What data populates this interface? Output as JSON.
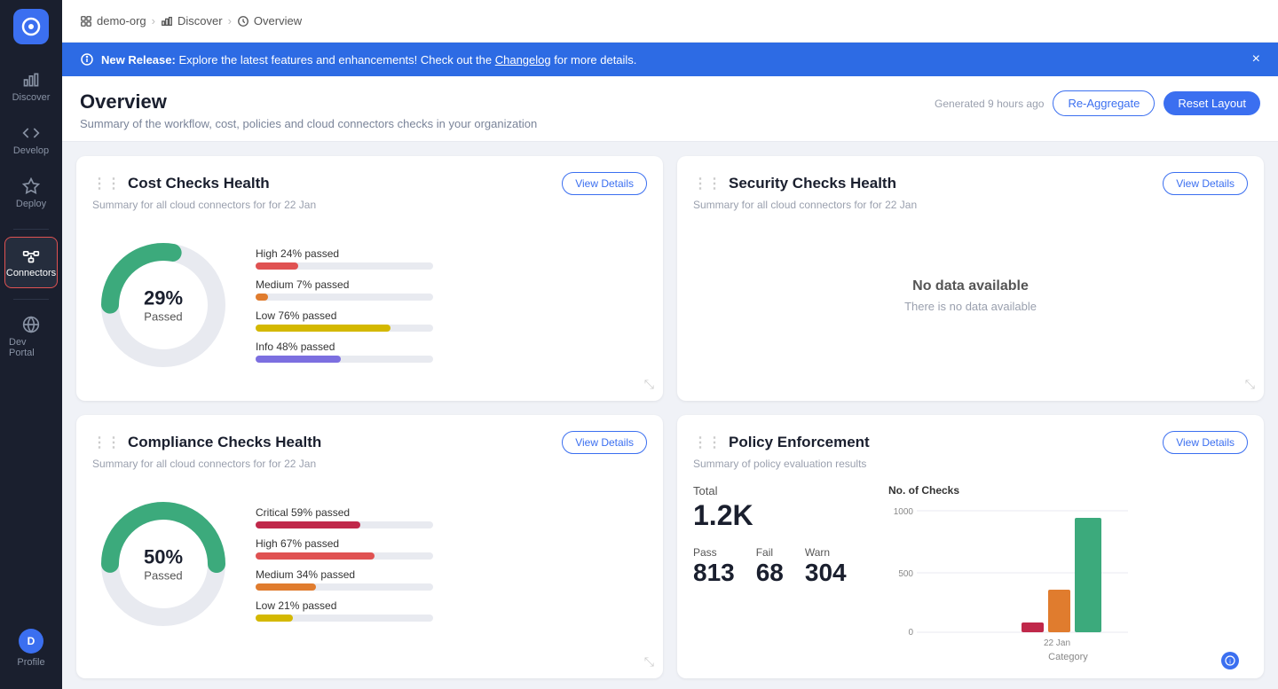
{
  "sidebar": {
    "logo": "app-logo",
    "items": [
      {
        "id": "discover",
        "label": "Discover",
        "icon": "bar-chart-icon",
        "active": false
      },
      {
        "id": "develop",
        "label": "Develop",
        "icon": "code-icon",
        "active": false
      },
      {
        "id": "deploy",
        "label": "Deploy",
        "icon": "deploy-icon",
        "active": false
      },
      {
        "id": "connectors",
        "label": "Connectors",
        "icon": "connectors-icon",
        "active": true
      },
      {
        "id": "dev-portal",
        "label": "Dev Portal",
        "icon": "portal-icon",
        "active": false
      }
    ],
    "bottom_items": [
      {
        "id": "profile",
        "label": "Profile",
        "icon": "profile-icon",
        "active": false
      }
    ]
  },
  "breadcrumb": {
    "items": [
      {
        "icon": "org-icon",
        "label": "demo-org"
      },
      {
        "icon": "discover-icon",
        "label": "Discover"
      },
      {
        "icon": "clock-icon",
        "label": "Overview"
      }
    ]
  },
  "banner": {
    "text_prefix": "New Release:",
    "text_body": " Explore the latest features and enhancements! Check out the ",
    "link_text": "Changelog",
    "text_suffix": " for more details.",
    "close_label": "×"
  },
  "page_header": {
    "title": "Overview",
    "subtitle": "Summary of the workflow, cost, policies and cloud connectors checks in your organization",
    "generated_text": "Generated 9 hours ago",
    "re_aggregate_label": "Re-Aggregate",
    "reset_layout_label": "Reset Layout"
  },
  "cost_checks": {
    "title": "Cost Checks Health",
    "subtitle": "Summary for all cloud connectors for for 22 Jan",
    "view_details": "View Details",
    "donut_pct": "29%",
    "donut_word": "Passed",
    "donut_value": 29,
    "bars": [
      {
        "label": "High 24% passed",
        "pct": 24,
        "color": "#e05252"
      },
      {
        "label": "Medium 7% passed",
        "pct": 7,
        "color": "#e07c2e"
      },
      {
        "label": "Low 76% passed",
        "pct": 76,
        "color": "#d4b800"
      },
      {
        "label": "Info 48% passed",
        "pct": 48,
        "color": "#7c6fe0"
      }
    ]
  },
  "security_checks": {
    "title": "Security Checks Health",
    "subtitle": "Summary for all cloud connectors for for 22 Jan",
    "view_details": "View Details",
    "no_data_title": "No data available",
    "no_data_text": "There is no data available"
  },
  "compliance_checks": {
    "title": "Compliance Checks Health",
    "subtitle": "Summary for all cloud connectors for for 22 Jan",
    "view_details": "View Details",
    "donut_pct": "50%",
    "donut_word": "Passed",
    "donut_value": 50,
    "bars": [
      {
        "label": "Critical 59% passed",
        "pct": 59,
        "color": "#c0284a"
      },
      {
        "label": "High 67% passed",
        "pct": 67,
        "color": "#e05252"
      },
      {
        "label": "Medium 34% passed",
        "pct": 34,
        "color": "#e07c2e"
      },
      {
        "label": "Low 21% passed",
        "pct": 21,
        "color": "#d4b800"
      }
    ]
  },
  "policy_enforcement": {
    "title": "Policy Enforcement",
    "subtitle": "Summary of policy evaluation results",
    "view_details": "View Details",
    "total_label": "Total",
    "total_value": "1.2K",
    "pass_label": "Pass",
    "pass_value": "813",
    "fail_label": "Fail",
    "fail_value": "68",
    "warn_label": "Warn",
    "warn_value": "304",
    "chart_title": "No. of Checks",
    "chart_y_labels": [
      "1000",
      "500",
      "0"
    ],
    "chart_x_label": "Category",
    "chart_date": "22 Jan",
    "chart_bars": [
      {
        "label": "Fail",
        "color": "#c0284a",
        "value": 68,
        "height_pct": 7
      },
      {
        "label": "Warn",
        "color": "#e07c2e",
        "value": 304,
        "height_pct": 30
      },
      {
        "label": "Pass",
        "color": "#3caa7c",
        "value": 813,
        "height_pct": 81
      }
    ]
  },
  "colors": {
    "accent_blue": "#3b6ff0",
    "sidebar_bg": "#1a1f2e",
    "teal": "#3caa7c"
  }
}
